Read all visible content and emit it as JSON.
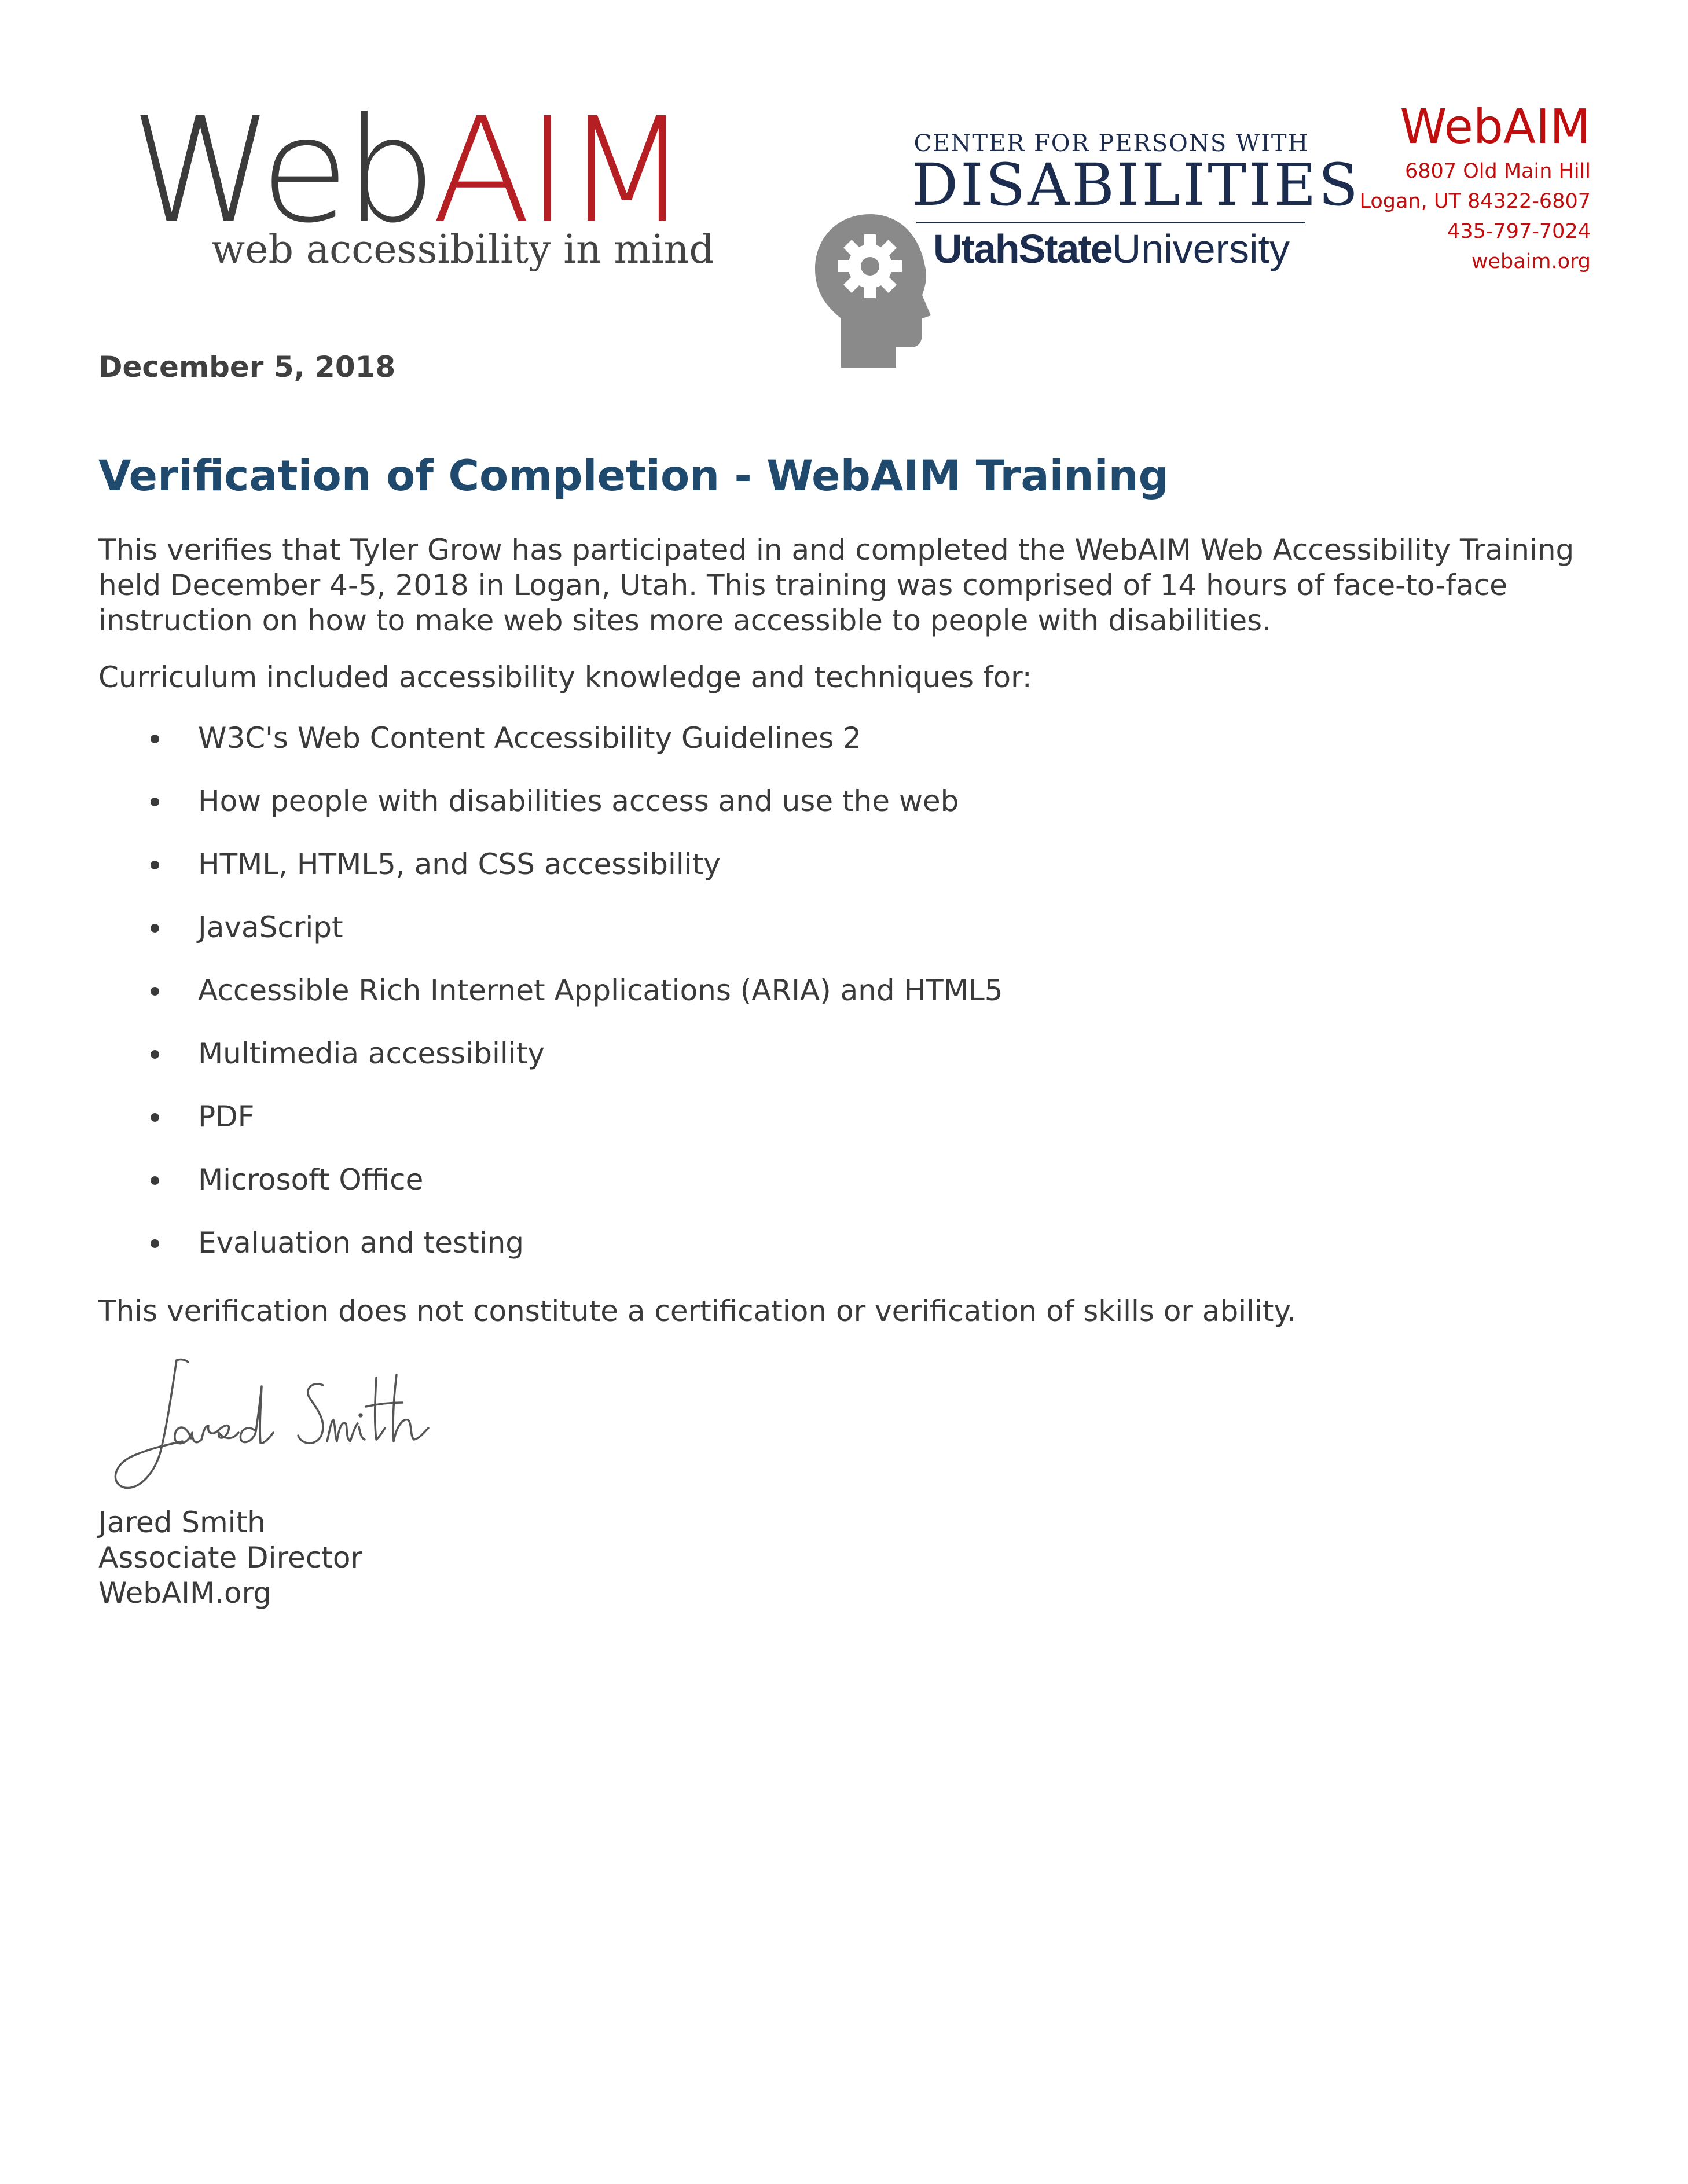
{
  "header": {
    "logo": {
      "web": "Web",
      "aim": "AIM",
      "tagline": "web accessibility in mind"
    },
    "partner": {
      "line1": "CENTER FOR PERSONS WITH",
      "line2": "DISABILITIES",
      "usu_bold": "UtahState",
      "usu_regular": "University"
    },
    "address": {
      "name": "WebAIM",
      "street": "6807 Old Main Hill",
      "city": "Logan, UT 84322-6807",
      "phone": "435-797-7024",
      "site": "webaim.org"
    }
  },
  "letter": {
    "date": "December 5, 2018",
    "title": "Verification of Completion - WebAIM Training",
    "intro": "This verifies that Tyler Grow has participated in and completed the WebAIM Web Accessibility Training held December 4-5, 2018 in Logan, Utah. This training was comprised of 14 hours of face-to-face instruction on how to make web sites more accessible to people with disabilities.",
    "curriculum_intro": "Curriculum included accessibility knowledge and techniques for:",
    "topics": [
      "W3C's Web Content Accessibility Guidelines 2",
      "How people with disabilities access and use the web",
      "HTML, HTML5, and CSS accessibility",
      "JavaScript",
      "Accessible Rich Internet Applications (ARIA) and HTML5",
      "Multimedia accessibility",
      "PDF",
      "Microsoft Office",
      "Evaluation and testing"
    ],
    "disclaimer": "This verification does not constitute a certification or verification of skills or ability.",
    "signature_text": "Jared Smith",
    "signer": {
      "name": "Jared Smith",
      "role": "Associate Director",
      "org": "WebAIM.org"
    }
  },
  "colors": {
    "brand_red": "#b51f24",
    "address_red": "#c00d0d",
    "title_blue": "#1f4a6e",
    "usu_navy": "#1b2c4f",
    "body_text": "#3a3a3a"
  }
}
